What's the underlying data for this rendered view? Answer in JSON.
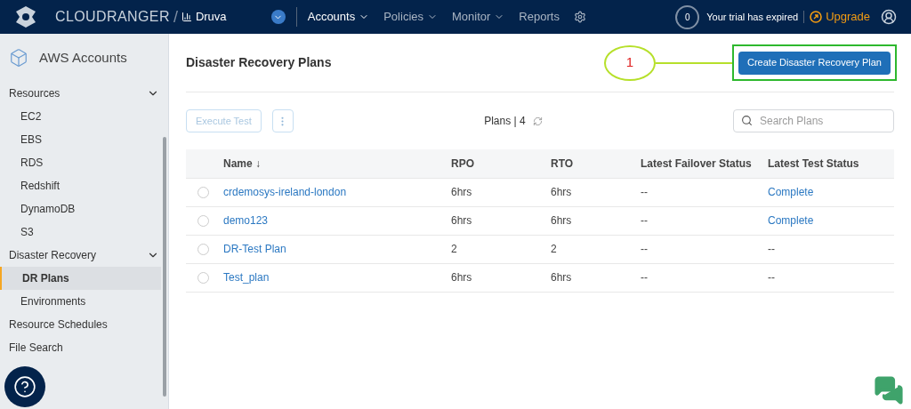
{
  "header": {
    "brand": "CLOUDRANGER",
    "separator": "/",
    "org": "Druva",
    "nav": [
      {
        "label": "Accounts",
        "selected": true,
        "dropdown": true
      },
      {
        "label": "Policies",
        "selected": false,
        "dropdown": true
      },
      {
        "label": "Monitor",
        "selected": false,
        "dropdown": true
      },
      {
        "label": "Reports",
        "selected": false,
        "dropdown": false
      }
    ],
    "notifications": "0",
    "trial": "Your trial has expired",
    "upgrade": "Upgrade"
  },
  "sidebar": {
    "title": "AWS Accounts",
    "items": [
      {
        "label": "Resources",
        "expanded": true,
        "children": [
          {
            "label": "EC2",
            "selected": false
          },
          {
            "label": "EBS",
            "selected": false
          },
          {
            "label": "RDS",
            "selected": false
          },
          {
            "label": "Redshift",
            "selected": false
          },
          {
            "label": "DynamoDB",
            "selected": false
          },
          {
            "label": "S3",
            "selected": false
          }
        ]
      },
      {
        "label": "Disaster Recovery",
        "expanded": true,
        "children": [
          {
            "label": "DR Plans",
            "selected": true
          },
          {
            "label": "Environments",
            "selected": false
          }
        ]
      },
      {
        "label": "Resource Schedules"
      },
      {
        "label": "File Search"
      }
    ]
  },
  "main": {
    "title": "Disaster Recovery Plans",
    "create_button": "Create Disaster Recovery Plan",
    "callout": "1",
    "execute_button": {
      "label": "Execute Test",
      "disabled": true
    },
    "count_label": "Plans | 4",
    "search": {
      "placeholder": "Search Plans"
    },
    "table": {
      "columns": [
        "Name ↓",
        "RPO",
        "RTO",
        "Latest Failover Status",
        "Latest Test Status"
      ],
      "rows": [
        {
          "selected": false,
          "cells": [
            "crdemosys-ireland-london",
            "6hrs",
            "6hrs",
            "--",
            "Complete"
          ]
        },
        {
          "selected": false,
          "cells": [
            "demo123",
            "6hrs",
            "6hrs",
            "--",
            "Complete"
          ]
        },
        {
          "selected": false,
          "cells": [
            "DR-Test Plan",
            "2",
            "2",
            "--",
            "--"
          ]
        },
        {
          "selected": false,
          "cells": [
            "Test_plan",
            "6hrs",
            "6hrs",
            "--",
            "--"
          ]
        }
      ]
    }
  }
}
